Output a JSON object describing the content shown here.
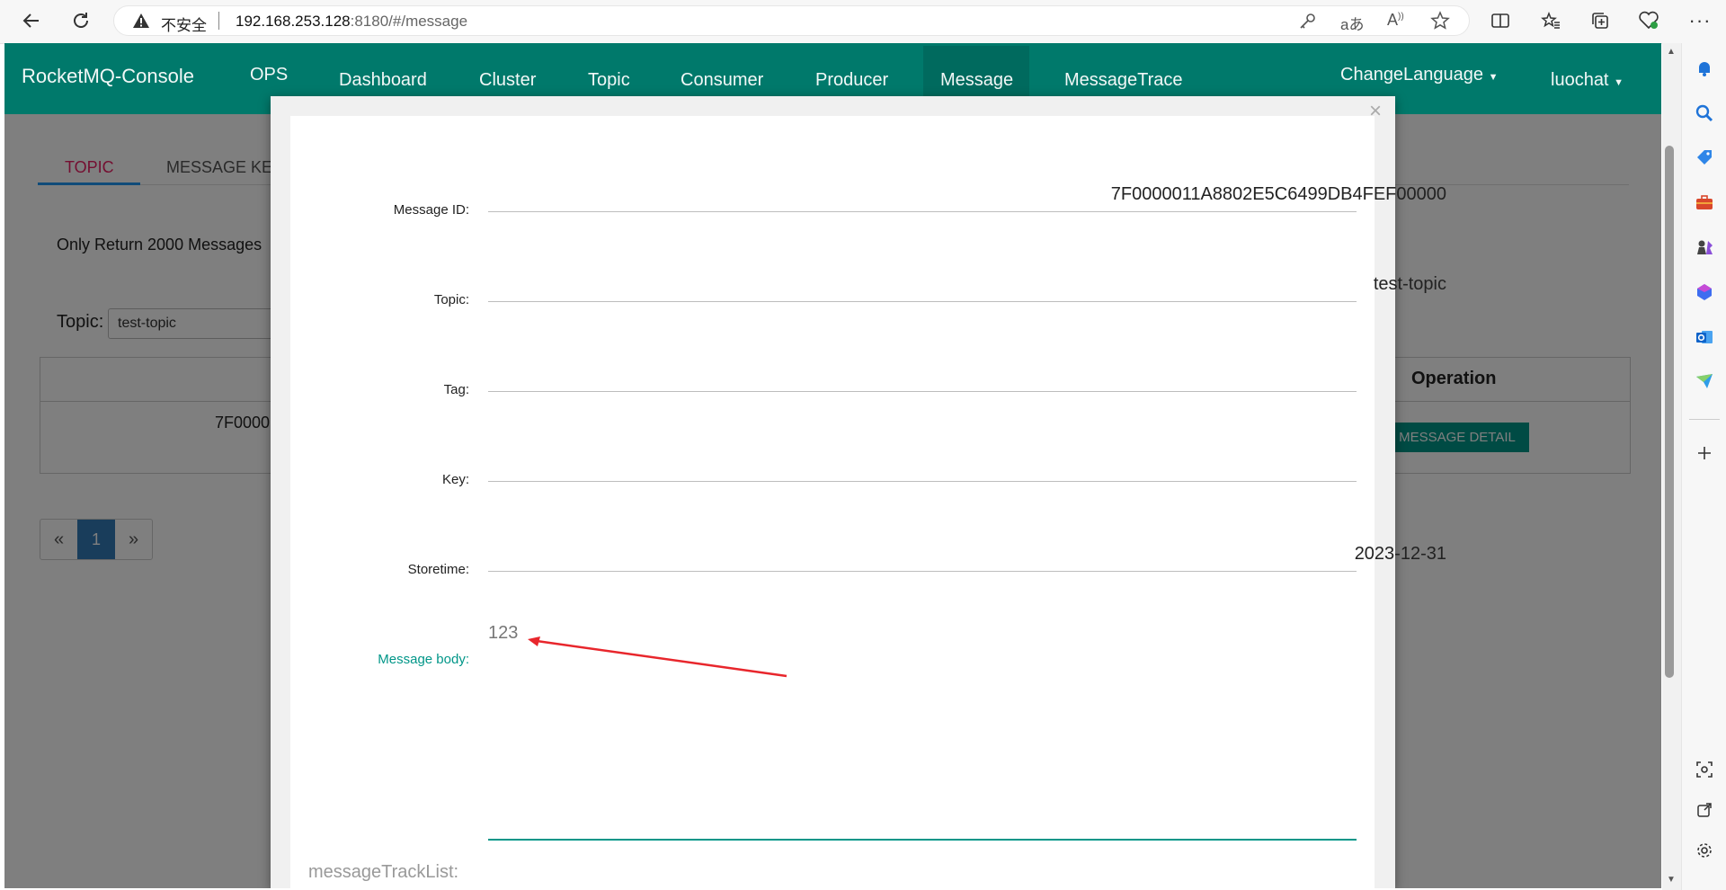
{
  "browser": {
    "security_warning": "不安全",
    "url_host": "192.168.253.128",
    "url_rest": ":8180/#/message"
  },
  "navbar": {
    "brand": "RocketMQ-Console",
    "ops": "OPS",
    "items": [
      "Dashboard",
      "Cluster",
      "Topic",
      "Consumer",
      "Producer",
      "Message",
      "MessageTrace"
    ],
    "active": "Message",
    "change_language": "ChangeLanguage",
    "user": "luochat"
  },
  "page": {
    "tabs": [
      "TOPIC",
      "MESSAGE KE"
    ],
    "notice": "Only Return 2000 Messages",
    "topic_label": "Topic:",
    "topic_value": "test-topic",
    "table_header_operation": "Operation",
    "table_cell_id": "7F0000",
    "detail_button": "MESSAGE DETAIL",
    "pagination": {
      "prev": "«",
      "current": "1",
      "next": "»"
    }
  },
  "modal": {
    "close": "×",
    "fields": {
      "message_id_label": "Message ID:",
      "message_id": "7F0000011A8802E5C6499DB4FEF00000",
      "topic_label": "Topic:",
      "topic": "test-topic",
      "tag_label": "Tag:",
      "tag": "",
      "key_label": "Key:",
      "key": "",
      "storetime_label": "Storetime:",
      "storetime": "2023-12-31",
      "body_label": "Message body:",
      "body": "123"
    },
    "track_list_label": "messageTrackList:"
  },
  "colors": {
    "navbar": "#00796b",
    "accent": "#009688",
    "tab_active": "#e91e63",
    "annotation_arrow": "#e8262c"
  }
}
